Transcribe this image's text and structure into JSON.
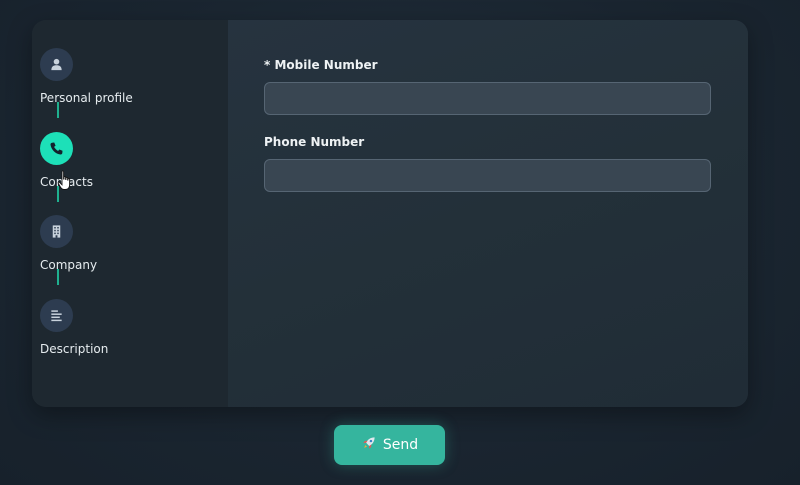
{
  "sidebar": {
    "steps": [
      {
        "label": "Personal profile",
        "icon": "person-icon",
        "active": false
      },
      {
        "label": "Contacts",
        "icon": "phone-icon",
        "active": true
      },
      {
        "label": "Company",
        "icon": "building-icon",
        "active": false
      },
      {
        "label": "Description",
        "icon": "align-left-icon",
        "active": false
      }
    ]
  },
  "form": {
    "mobile_label": "* Mobile Number",
    "mobile_value": "",
    "phone_label": "Phone Number",
    "phone_value": ""
  },
  "send_button": {
    "label": "Send",
    "icon": "rocket-icon"
  },
  "colors": {
    "accent": "#1de0b8",
    "button": "#35b59e",
    "step_inactive": "#2d3c50",
    "background": "#1b2631"
  }
}
